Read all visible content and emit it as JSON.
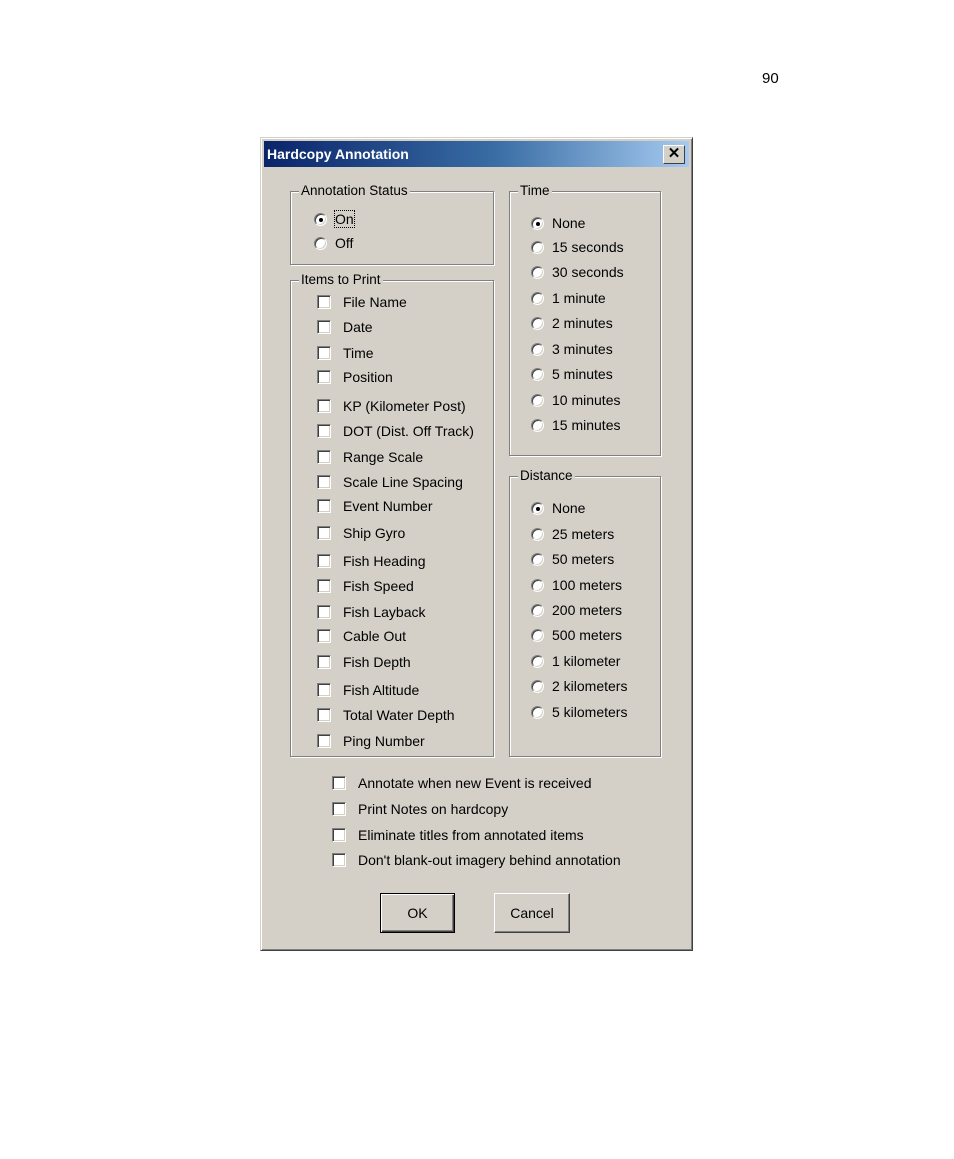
{
  "page": {
    "number": "90"
  },
  "dialog": {
    "title": "Hardcopy Annotation",
    "close_icon": "close-icon",
    "annotation_status": {
      "label": "Annotation Status",
      "options": [
        {
          "label": "On",
          "selected": true
        },
        {
          "label": "Off",
          "selected": false
        }
      ]
    },
    "items_to_print": {
      "label": "Items to Print",
      "items": [
        {
          "label": "File Name",
          "checked": false
        },
        {
          "label": "Date",
          "checked": false
        },
        {
          "label": "Time",
          "checked": false
        },
        {
          "label": "Position",
          "checked": false
        },
        {
          "label": "KP (Kilometer Post)",
          "checked": false
        },
        {
          "label": "DOT (Dist. Off Track)",
          "checked": false
        },
        {
          "label": "Range Scale",
          "checked": false
        },
        {
          "label": "Scale Line Spacing",
          "checked": false
        },
        {
          "label": "Event Number",
          "checked": false
        },
        {
          "label": "Ship Gyro",
          "checked": false
        },
        {
          "label": "Fish Heading",
          "checked": false
        },
        {
          "label": "Fish Speed",
          "checked": false
        },
        {
          "label": "Fish Layback",
          "checked": false
        },
        {
          "label": "Cable Out",
          "checked": false
        },
        {
          "label": "Fish Depth",
          "checked": false
        },
        {
          "label": "Fish Altitude",
          "checked": false
        },
        {
          "label": "Total Water Depth",
          "checked": false
        },
        {
          "label": "Ping Number",
          "checked": false
        }
      ]
    },
    "time": {
      "label": "Time",
      "options": [
        {
          "label": "None",
          "selected": true
        },
        {
          "label": "15 seconds",
          "selected": false
        },
        {
          "label": "30 seconds",
          "selected": false
        },
        {
          "label": "1 minute",
          "selected": false
        },
        {
          "label": "2 minutes",
          "selected": false
        },
        {
          "label": "3 minutes",
          "selected": false
        },
        {
          "label": "5 minutes",
          "selected": false
        },
        {
          "label": "10 minutes",
          "selected": false
        },
        {
          "label": "15 minutes",
          "selected": false
        }
      ]
    },
    "distance": {
      "label": "Distance",
      "options": [
        {
          "label": "None",
          "selected": true
        },
        {
          "label": "25 meters",
          "selected": false
        },
        {
          "label": "50 meters",
          "selected": false
        },
        {
          "label": "100 meters",
          "selected": false
        },
        {
          "label": "200 meters",
          "selected": false
        },
        {
          "label": "500 meters",
          "selected": false
        },
        {
          "label": "1 kilometer",
          "selected": false
        },
        {
          "label": "2 kilometers",
          "selected": false
        },
        {
          "label": "5 kilometers",
          "selected": false
        }
      ]
    },
    "options": [
      {
        "label": "Annotate when new Event is received",
        "checked": false
      },
      {
        "label": "Print Notes on hardcopy",
        "checked": false
      },
      {
        "label": "Eliminate titles from annotated items",
        "checked": false
      },
      {
        "label": "Don't blank-out imagery behind annotation",
        "checked": false
      }
    ],
    "buttons": {
      "ok": "OK",
      "cancel": "Cancel"
    }
  }
}
